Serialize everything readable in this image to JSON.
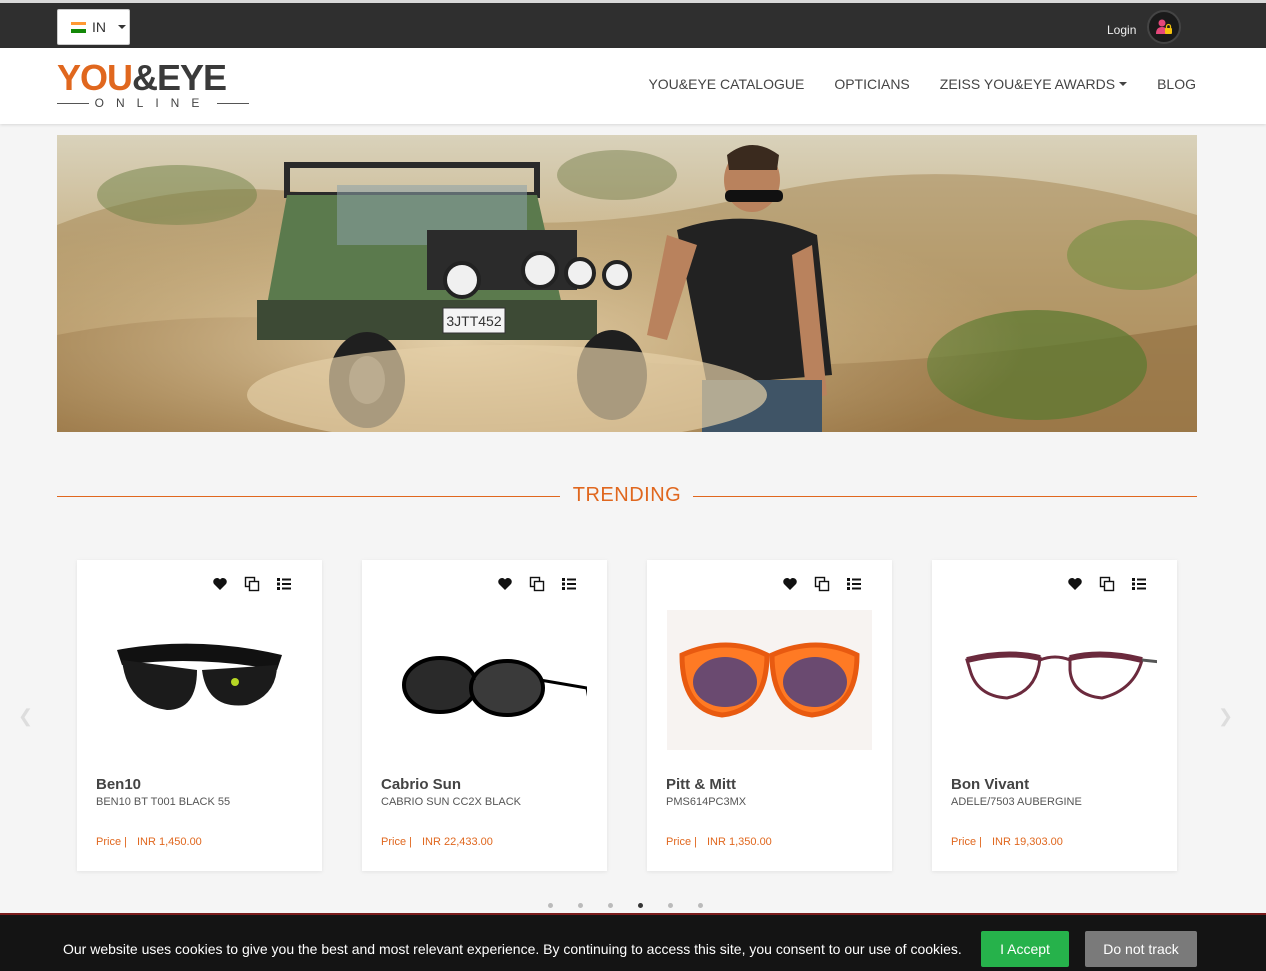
{
  "topbar": {
    "country_code": "IN",
    "login_label": "Login",
    "flag_colors": [
      "#ff9933",
      "#ffffff",
      "#138808"
    ]
  },
  "logo": {
    "main_part1": "YOU",
    "main_amp": "&",
    "main_part2": "EYE",
    "sub": "ONLINE"
  },
  "nav": {
    "items": [
      {
        "label": "YOU&EYE CATALOGUE",
        "has_dropdown": false
      },
      {
        "label": "OPTICIANS",
        "has_dropdown": false
      },
      {
        "label": "ZEISS YOU&EYE AWARDS",
        "has_dropdown": true
      },
      {
        "label": "BLOG",
        "has_dropdown": false
      }
    ]
  },
  "hero": {
    "plate_text": "3JTT452"
  },
  "trending": {
    "title": "TRENDING"
  },
  "products": [
    {
      "brand": "Ben10",
      "model": "BEN10 BT T001 BLACK 55",
      "price_label": "Price |",
      "price": "INR 1,450.00"
    },
    {
      "brand": "Cabrio Sun",
      "model": "CABRIO SUN CC2X BLACK",
      "price_label": "Price |",
      "price": "INR 22,433.00"
    },
    {
      "brand": "Pitt & Mitt",
      "model": "PMS614PC3MX",
      "price_label": "Price |",
      "price": "INR 1,350.00"
    },
    {
      "brand": "Bon Vivant",
      "model": "ADELE/7503 AUBERGINE",
      "price_label": "Price |",
      "price": "INR 19,303.00"
    }
  ],
  "carousel": {
    "dot_count": 6,
    "active_dot": 4
  },
  "cookie": {
    "message": "Our website uses cookies to give you the best and most relevant experience. By continuing to access this site, you consent to our use of cookies.",
    "accept_label": "I Accept",
    "track_label": "Do not track"
  },
  "colors": {
    "accent": "#e0671e",
    "topbar": "#2f2f2f",
    "accept": "#26b24b"
  }
}
